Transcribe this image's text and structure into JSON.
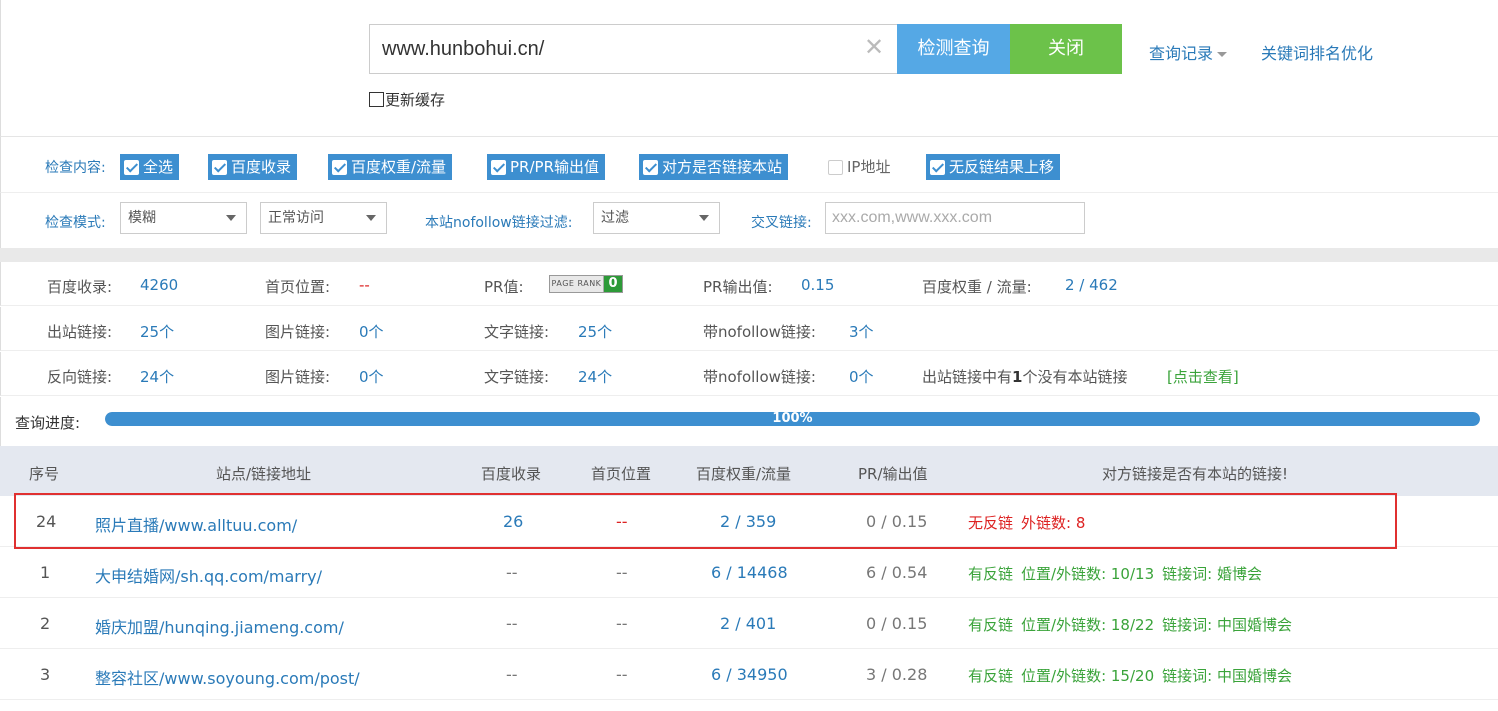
{
  "search": {
    "url_value": "www.hunbohui.cn/",
    "check_button": "检测查询",
    "close_button": "关闭",
    "history_link": "查询记录",
    "keyword_link": "关键词排名优化",
    "refresh_cache_label": "更新缓存"
  },
  "options": {
    "content_label": "检查内容:",
    "checkboxes": [
      {
        "label": "全选",
        "checked": true
      },
      {
        "label": "百度收录",
        "checked": true
      },
      {
        "label": "百度权重/流量",
        "checked": true
      },
      {
        "label": "PR/PR输出值",
        "checked": true
      },
      {
        "label": "对方是否链接本站",
        "checked": true
      },
      {
        "label": "IP地址",
        "checked": false
      },
      {
        "label": "无反链结果上移",
        "checked": true
      }
    ],
    "mode_label": "检查模式:",
    "mode_select": "模糊",
    "access_select": "正常访问",
    "nofollow_label": "本站nofollow链接过滤:",
    "nofollow_select": "过滤",
    "cross_label": "交叉链接:",
    "cross_placeholder": "xxx.com,www.xxx.com"
  },
  "stats": {
    "row1": {
      "baidu_index_label": "百度收录:",
      "baidu_index_value": "4260",
      "homepage_label": "首页位置:",
      "homepage_value": "--",
      "pr_label": "PR值:",
      "pr_badge_text": "PAGE RANK",
      "pr_badge_value": "0",
      "pr_output_label": "PR输出值:",
      "pr_output_value": "0.15",
      "weight_label": "百度权重 / 流量:",
      "weight_value": "2 / 462"
    },
    "row2": {
      "outbound_label": "出站链接:",
      "outbound_value": "25个",
      "image_label": "图片链接:",
      "image_value": "0个",
      "text_label": "文字链接:",
      "text_value": "25个",
      "nofollow_label": "带nofollow链接:",
      "nofollow_value": "3个"
    },
    "row3": {
      "backlink_label": "反向链接:",
      "backlink_value": "24个",
      "image_label": "图片链接:",
      "image_value": "0个",
      "text_label": "文字链接:",
      "text_value": "24个",
      "nofollow_label": "带nofollow链接:",
      "nofollow_value": "0个",
      "note_prefix": "出站链接中有",
      "note_count": "1",
      "note_suffix": "个没有本站链接",
      "view_link": "[点击查看]"
    }
  },
  "progress": {
    "label": "查询进度:",
    "percent_text": "100%",
    "fraction": 1.0
  },
  "table": {
    "headers": [
      "序号",
      "站点/链接地址",
      "百度收录",
      "首页位置",
      "百度权重/流量",
      "PR/输出值",
      "对方链接是否有本站的链接!"
    ],
    "rows": [
      {
        "no": "24",
        "site": "照片直播/www.alltuu.com/",
        "index": "26",
        "home": "--",
        "weight": "2 / 359",
        "pr": "0 / 0.15",
        "status": "无反链",
        "detail": "外链数: 8",
        "has_backlink": false
      },
      {
        "no": "1",
        "site": "大申结婚网/sh.qq.com/marry/",
        "index": "--",
        "home": "--",
        "weight": "6 / 14468",
        "pr": "6 / 0.54",
        "status": "有反链",
        "detail": "位置/外链数: 10/13",
        "anchor": "链接词: 婚博会",
        "has_backlink": true
      },
      {
        "no": "2",
        "site": "婚庆加盟/hunqing.jiameng.com/",
        "index": "--",
        "home": "--",
        "weight": "2 / 401",
        "pr": "0 / 0.15",
        "status": "有反链",
        "detail": "位置/外链数: 18/22",
        "anchor": "链接词: 中国婚博会",
        "has_backlink": true
      },
      {
        "no": "3",
        "site": "整容社区/www.soyoung.com/post/",
        "index": "--",
        "home": "--",
        "weight": "6 / 34950",
        "pr": "3 / 0.28",
        "status": "有反链",
        "detail": "位置/外链数: 15/20",
        "anchor": "链接词: 中国婚博会",
        "has_backlink": true
      }
    ]
  },
  "colors": {
    "accent_blue": "#3d8fd0",
    "check_button": "#55a8e5",
    "close_button": "#6cc24a",
    "link": "#2a7ab8",
    "warning_red": "#d22222",
    "success_green": "#3aa33a",
    "highlight_border": "#e03030"
  }
}
